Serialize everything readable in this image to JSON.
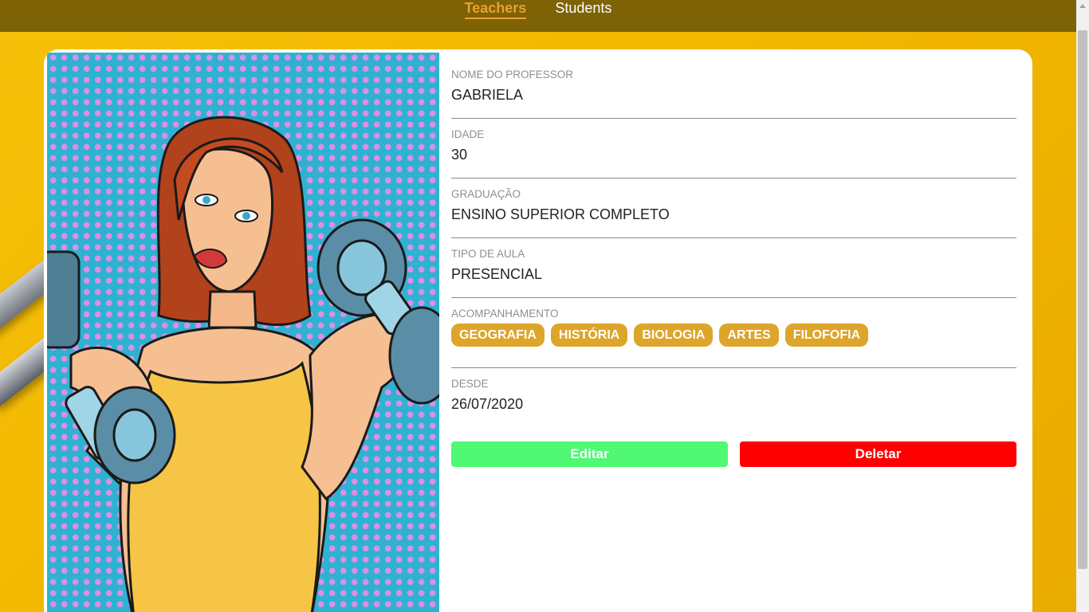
{
  "nav": {
    "items": [
      {
        "label": "Teachers",
        "active": true
      },
      {
        "label": "Students",
        "active": false
      }
    ]
  },
  "teacher": {
    "photo_alt": "woman-lifting-dumbbells-illustration",
    "fields": [
      {
        "label": "NOME DO PROFESSOR",
        "value": "GABRIELA"
      },
      {
        "label": "IDADE",
        "value": "30"
      },
      {
        "label": "GRADUAÇÃO",
        "value": "ENSINO SUPERIOR COMPLETO"
      },
      {
        "label": "TIPO DE AULA",
        "value": "PRESENCIAL"
      }
    ],
    "subjects_label": "ACOMPANHAMENTO",
    "subjects": [
      "GEOGRAFIA",
      "HISTÓRIA",
      "BIOLOGIA",
      "ARTES",
      "FILOFOFIA"
    ],
    "since_label": "DESDE",
    "since_value": "26/07/2020"
  },
  "actions": {
    "edit_label": "Editar",
    "delete_label": "Deletar"
  },
  "colors": {
    "background": "#f2b700",
    "topbar": "#7d6206",
    "accent": "#e8a22a",
    "chip": "#dda52a",
    "edit": "#51f874",
    "delete": "#ff0000"
  }
}
